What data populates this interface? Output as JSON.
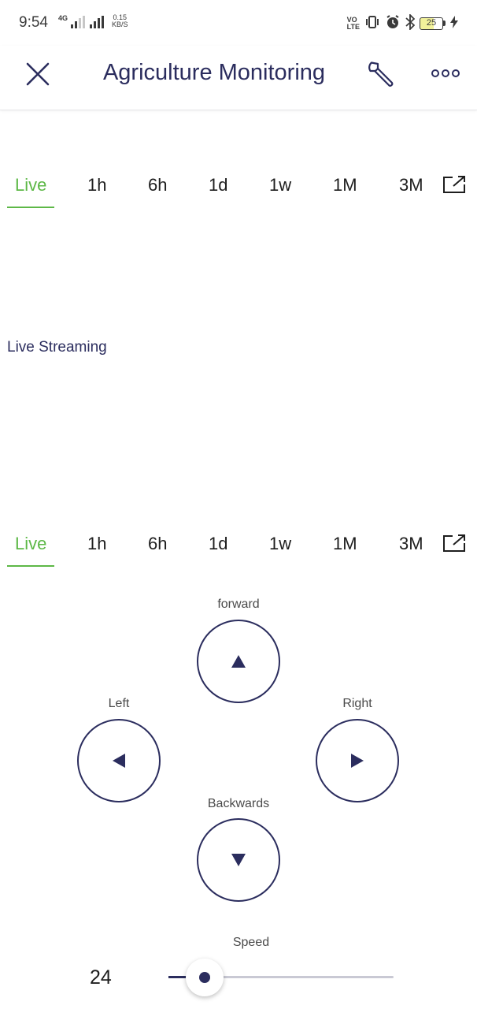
{
  "status_bar": {
    "time": "9:54",
    "network_type": "4G",
    "net_speed_value": "0.15",
    "net_speed_unit": "KB/S",
    "volte_top": "VO",
    "volte_bottom": "LTE",
    "battery_level": "25"
  },
  "header": {
    "title": "Agriculture Monitoring"
  },
  "range_tabs_top": {
    "active": "Live",
    "tabs": [
      "Live",
      "1h",
      "6h",
      "1d",
      "1w",
      "1M",
      "3M"
    ]
  },
  "stream_label": "Live Streaming",
  "range_tabs_bottom": {
    "active": "Live",
    "tabs": [
      "Live",
      "1h",
      "6h",
      "1d",
      "1w",
      "1M",
      "3M"
    ]
  },
  "controls": {
    "forward_label": "forward",
    "left_label": "Left",
    "right_label": "Right",
    "backwards_label": "Backwards",
    "forward_icon": "▲",
    "left_icon": "◀",
    "right_icon": "▶",
    "backwards_icon": "▼"
  },
  "speed": {
    "label": "Speed",
    "value": "24",
    "slider_fraction": 0.09
  },
  "colors": {
    "primary": "#2b2d5e",
    "accent_green": "#5db847"
  }
}
